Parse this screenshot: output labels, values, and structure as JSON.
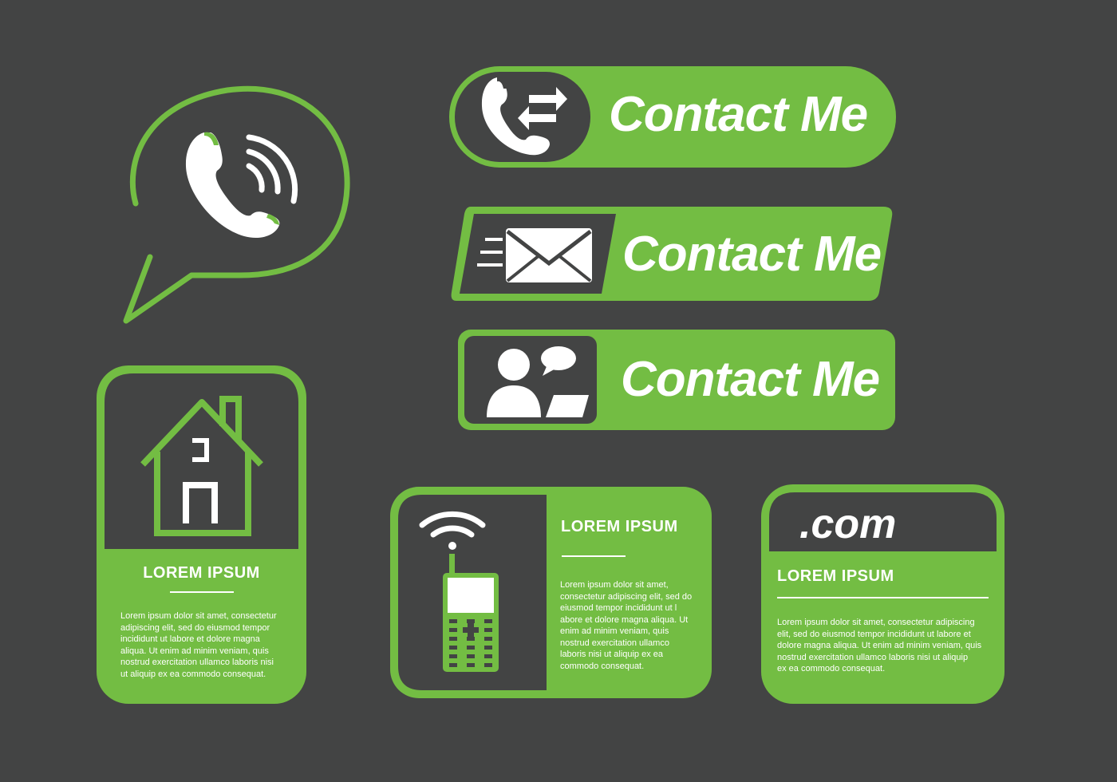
{
  "colors": {
    "background": "#434444",
    "green": "#73bd43",
    "dark": "#434444",
    "white": "#ffffff"
  },
  "buttons": [
    {
      "label": "Contact Me",
      "icon": "phone-transfer-icon"
    },
    {
      "label": "Contact Me",
      "icon": "envelope-icon"
    },
    {
      "label": "Contact Me",
      "icon": "chat-person-icon"
    }
  ],
  "speech_bubble": {
    "icon": "phone-ringing-icon"
  },
  "cards": {
    "home": {
      "icon": "house-icon",
      "title": "LOREM IPSUM",
      "body_lines": [
        "Lorem ipsum dolor sit amet, consectetur",
        "adipiscing elit, sed do eiusmod tempor",
        "incididunt ut labore et dolore magna",
        "aliqua. Ut enim ad minim veniam, quis",
        "nostrud exercitation ullamco laboris nisi",
        "ut aliquip ex ea commodo consequat."
      ]
    },
    "mobile": {
      "icon": "mobile-phone-icon",
      "title": "LOREM IPSUM",
      "body_lines": [
        "Lorem ipsum dolor sit amet,",
        "consectetur adipiscing elit, sed do",
        "eiusmod tempor incididunt ut l",
        "abore et dolore magna aliqua. Ut",
        "enim ad minim veniam, quis",
        "nostrud exercitation ullamco",
        "laboris nisi ut aliquip ex ea",
        "commodo consequat."
      ]
    },
    "web": {
      "header_text": ".com",
      "title": "LOREM IPSUM",
      "body_lines": [
        "Lorem ipsum dolor sit amet, consectetur adipiscing",
        "elit, sed do eiusmod tempor incididunt ut labore et",
        "dolore magna aliqua. Ut enim ad minim veniam, quis",
        "nostrud exercitation ullamco laboris nisi ut aliquip",
        "ex ea commodo consequat."
      ]
    }
  }
}
